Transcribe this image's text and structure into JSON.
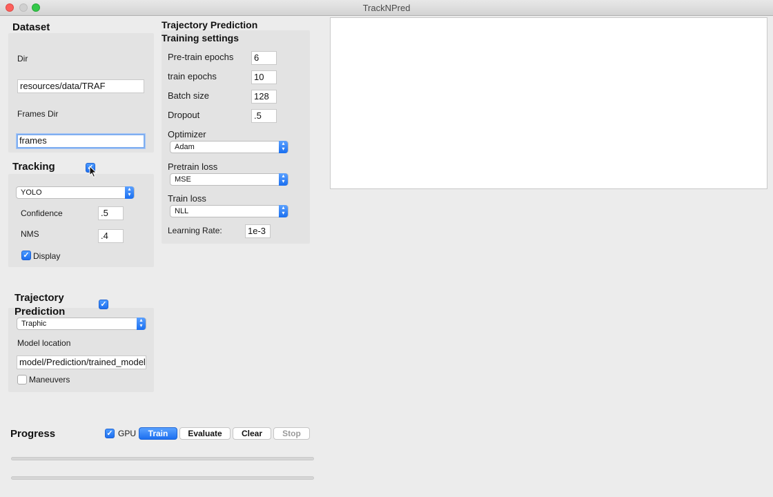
{
  "window": {
    "title": "TrackNPred"
  },
  "dataset": {
    "heading": "Dataset",
    "dir_label": "Dir",
    "dir_value": "resources/data/TRAF",
    "frames_dir_label": "Frames Dir",
    "frames_dir_value": "frames"
  },
  "tracking": {
    "heading": "Tracking",
    "enabled": true,
    "model": "YOLO",
    "confidence_label": "Confidence",
    "confidence_value": ".5",
    "nms_label": "NMS",
    "nms_value": ".4",
    "display_label": "Display",
    "display_checked": true
  },
  "prediction": {
    "heading_line1": "Trajectory",
    "heading_line2": "Prediction",
    "enabled": true,
    "model": "Traphic",
    "model_location_label": "Model location",
    "model_location_value": "model/Prediction/trained_models",
    "maneuvers_label": "Maneuvers",
    "maneuvers_checked": false
  },
  "training": {
    "section_title": "Trajectory Prediction",
    "heading": "Training settings",
    "pretrain_epochs_label": "Pre-train epochs",
    "pretrain_epochs_value": "6",
    "train_epochs_label": "train epochs",
    "train_epochs_value": "10",
    "batch_size_label": "Batch size",
    "batch_size_value": "128",
    "dropout_label": "Dropout",
    "dropout_value": ".5",
    "optimizer_label": "Optimizer",
    "optimizer_value": "Adam",
    "pretrain_loss_label": "Pretrain loss",
    "pretrain_loss_value": "MSE",
    "train_loss_label": "Train loss",
    "train_loss_value": "NLL",
    "learning_rate_label": "Learning Rate:",
    "learning_rate_value": "1e-3"
  },
  "progress": {
    "heading": "Progress",
    "gpu_label": "GPU",
    "gpu_checked": true,
    "train_label": "Train",
    "evaluate_label": "Evaluate",
    "clear_label": "Clear",
    "stop_label": "Stop",
    "bar1_value": 0,
    "bar2_value": 0
  },
  "colors": {
    "accent": "#1c6ff0",
    "window_bg": "#ececec",
    "panel_bg": "#e3e3e3"
  }
}
